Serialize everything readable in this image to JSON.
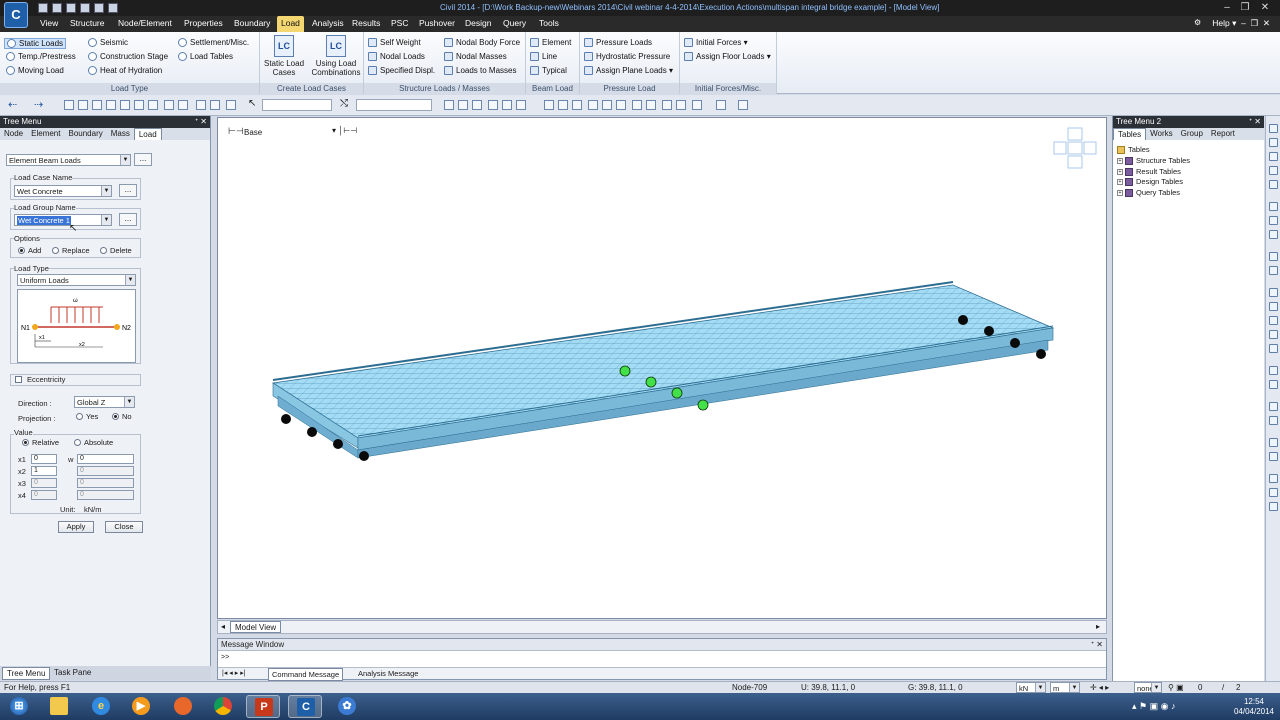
{
  "window": {
    "title": "Civil 2014 - [D:\\Work Backup-new\\Webinars 2014\\Civil webinar 4-4-2014\\Execution Actions\\multispan integral bridge example] - [Model View]",
    "app_logo": "C"
  },
  "menubar": {
    "items": [
      "View",
      "Structure",
      "Node/Element",
      "Properties",
      "Boundary",
      "Load",
      "Analysis",
      "Results",
      "PSC",
      "Pushover",
      "Design",
      "Query",
      "Tools"
    ],
    "active": "Load",
    "help_label": "Help"
  },
  "ribbon": {
    "load_type": {
      "label": "Load Type",
      "items": [
        "Static Loads",
        "Temp./Prestress",
        "Moving Load",
        "Seismic",
        "Construction Stage",
        "Heat of Hydration",
        "Settlement/Misc.",
        "Load Tables"
      ]
    },
    "create_load_cases": {
      "label": "Create Load Cases",
      "static_load_cases": "Static Load Cases",
      "using_load_combinations": "Using Load Combinations"
    },
    "structure_loads": {
      "label": "Structure Loads / Masses",
      "items": [
        "Self Weight",
        "Nodal Loads",
        "Specified Displ.",
        "Nodal Body Force",
        "Nodal Masses",
        "Loads to Masses"
      ]
    },
    "beam_load": {
      "label": "Beam Load",
      "items": [
        "Element",
        "Line",
        "Typical"
      ]
    },
    "pressure_load": {
      "label": "Pressure Load",
      "items": [
        "Pressure Loads",
        "Hydrostatic Pressure",
        "Assign Plane Loads"
      ]
    },
    "initial_forces": {
      "label": "Initial Forces/Misc.",
      "items": [
        "Initial Forces",
        "Assign Floor Loads"
      ]
    }
  },
  "tree_menu": {
    "title": "Tree Menu",
    "tabs": [
      "Node",
      "Element",
      "Boundary",
      "Mass",
      "Load"
    ],
    "active_tab": "Load",
    "function_select": "Element Beam Loads",
    "load_case_name_label": "Load Case Name",
    "load_case_name": "Wet Concrete",
    "load_group_name_label": "Load Group Name",
    "load_group_name": "Wet Concrete 1",
    "options_label": "Options",
    "options": [
      "Add",
      "Replace",
      "Delete"
    ],
    "options_selected": "Add",
    "load_type_label": "Load Type",
    "load_type": "Uniform Loads",
    "diagram": {
      "w": "ω",
      "n1": "N1",
      "n2": "N2",
      "x1": "x1",
      "x2": "x2"
    },
    "eccentricity_label": "Eccentricity",
    "direction_label": "Direction  :",
    "direction": "Global Z",
    "projection_label": "Projection :",
    "projection_options": [
      "Yes",
      "No"
    ],
    "projection_selected": "No",
    "value_label": "Value",
    "value_modes": [
      "Relative",
      "Absolute"
    ],
    "value_mode_selected": "Relative",
    "rows": [
      {
        "x_label": "x1",
        "x": "0",
        "w_label": "w",
        "w": "0"
      },
      {
        "x_label": "x2",
        "x": "1",
        "w_label": "",
        "w": "0"
      },
      {
        "x_label": "x3",
        "x": "0",
        "w_label": "",
        "w": "0"
      },
      {
        "x_label": "x4",
        "x": "0",
        "w_label": "",
        "w": "0"
      }
    ],
    "unit_label": "Unit:",
    "unit_value": "kN/m",
    "apply_label": "Apply",
    "close_label": "Close",
    "bottom_tabs": [
      "Tree Menu",
      "Task Pane"
    ]
  },
  "model_view": {
    "tab_label": "Model View",
    "level_combo": "Base"
  },
  "message_window": {
    "title": "Message Window",
    "prompt": ">>",
    "tabs": [
      "Command Message",
      "Analysis Message"
    ]
  },
  "tree_menu_2": {
    "title": "Tree Menu 2",
    "tabs": [
      "Tables",
      "Works",
      "Group",
      "Report"
    ],
    "active_tab": "Tables",
    "root": "Tables",
    "children": [
      "Structure Tables",
      "Result Tables",
      "Design Tables",
      "Query Tables"
    ]
  },
  "statusbar": {
    "help_text": "For Help, press F1",
    "node": "Node-709",
    "u_coords": "U: 39.8, 11.1, 0",
    "g_coords": "G: 39.8, 11.1, 0",
    "force_unit": "kN",
    "length_unit": "m",
    "combo_none": "none",
    "page_current": "0",
    "page_total": "2"
  },
  "taskbar": {
    "time": "12:54",
    "date": "04/04/2014"
  },
  "colors": {
    "title_bg": "#1e1e1e",
    "menu_active": "#f4d770",
    "deck": "#8fd3f2",
    "support_dot": "#44e04a"
  }
}
